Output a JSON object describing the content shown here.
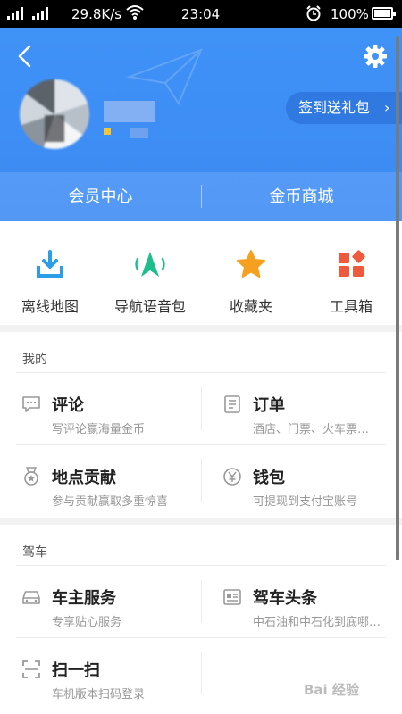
{
  "status": {
    "speed": "29.8K/s",
    "time": "23:04",
    "battery": "100%"
  },
  "header": {
    "signin_label": "签到送礼包",
    "signin_chevron": "›"
  },
  "member": {
    "left": "会员中心",
    "right": "金币商城"
  },
  "quick": [
    {
      "label": "离线地图",
      "icon": "download-icon",
      "color": "#2c9ee8"
    },
    {
      "label": "导航语音包",
      "icon": "navigation-voice-icon",
      "color": "#1cbf8c"
    },
    {
      "label": "收藏夹",
      "icon": "star-icon",
      "color": "#f6a020"
    },
    {
      "label": "工具箱",
      "icon": "toolbox-icon",
      "color": "#f05a3c"
    }
  ],
  "mine": {
    "title": "我的",
    "items": [
      {
        "title": "评论",
        "sub": "写评论赢海量金币",
        "icon": "comment-icon"
      },
      {
        "title": "订单",
        "sub": "酒店、门票、火车票…",
        "icon": "order-icon"
      },
      {
        "title": "地点贡献",
        "sub": "参与贡献赢取多重惊喜",
        "icon": "medal-icon"
      },
      {
        "title": "钱包",
        "sub": "可提现到支付宝账号",
        "icon": "wallet-icon"
      }
    ]
  },
  "drive": {
    "title": "驾车",
    "items": [
      {
        "title": "车主服务",
        "sub": "专享贴心服务",
        "icon": "car-icon"
      },
      {
        "title": "驾车头条",
        "sub": "中石油和中石化到底哪…",
        "icon": "news-icon"
      },
      {
        "title": "扫一扫",
        "sub": "车机版本扫码登录",
        "icon": "scan-icon"
      }
    ]
  }
}
